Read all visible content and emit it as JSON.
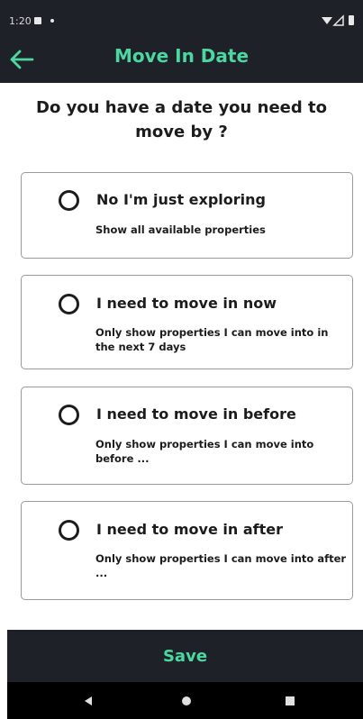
{
  "status_bar": {
    "time": "1:20"
  },
  "header": {
    "title": "Move In Date"
  },
  "question": "Do you have a date you need to move by ?",
  "options": [
    {
      "title": "No I'm just exploring",
      "description": "Show all available properties"
    },
    {
      "title": "I need to move in now",
      "description": "Only show properties I can move into in the next 7 days"
    },
    {
      "title": "I need to move in before",
      "description": "Only show properties I can move into before ..."
    },
    {
      "title": "I need to move in after",
      "description": "Only show properties I can move into after ..."
    }
  ],
  "save_label": "Save",
  "colors": {
    "accent": "#4cd6a2",
    "dark": "#1f2128"
  },
  "icons": {
    "back": "arrow-left-icon",
    "nav": [
      "back-triangle-icon",
      "home-circle-icon",
      "recents-square-icon"
    ]
  }
}
